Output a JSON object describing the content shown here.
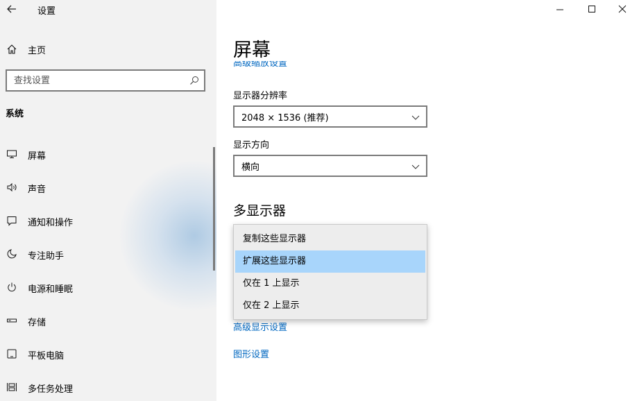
{
  "window": {
    "title": "设置"
  },
  "sidebar": {
    "home_label": "主页",
    "search_placeholder": "查找设置",
    "section_title": "系统",
    "items": [
      {
        "label": "屏幕",
        "icon": "monitor-icon"
      },
      {
        "label": "声音",
        "icon": "speaker-icon"
      },
      {
        "label": "通知和操作",
        "icon": "notification-icon"
      },
      {
        "label": "专注助手",
        "icon": "moon-icon"
      },
      {
        "label": "电源和睡眠",
        "icon": "power-icon"
      },
      {
        "label": "存储",
        "icon": "storage-icon"
      },
      {
        "label": "平板电脑",
        "icon": "tablet-icon"
      },
      {
        "label": "多任务处理",
        "icon": "multitask-icon"
      }
    ]
  },
  "main": {
    "page_title": "屏幕",
    "cut_link": "高级缩放设置",
    "resolution": {
      "label": "显示器分辨率",
      "value": "2048 × 1536 (推荐)"
    },
    "orientation": {
      "label": "显示方向",
      "value": "横向"
    },
    "multi_display": {
      "heading": "多显示器",
      "options": [
        "复制这些显示器",
        "扩展这些显示器",
        "仅在 1 上显示",
        "仅在 2 上显示"
      ],
      "selected_index": 1
    },
    "links": {
      "advanced_display": "高级显示设置",
      "graphics": "图形设置"
    }
  },
  "colors": {
    "accent_link": "#0067c0",
    "selection": "#a8d5fb",
    "sidebar_bg": "#f2f2f2"
  }
}
